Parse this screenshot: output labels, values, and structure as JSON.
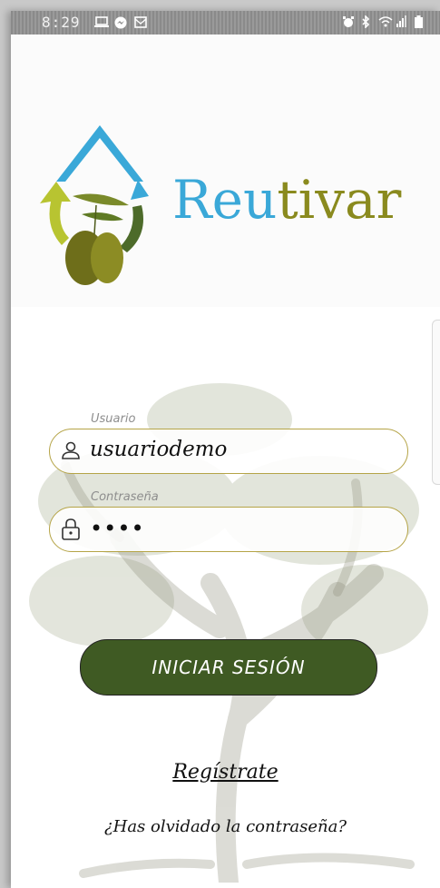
{
  "status_bar": {
    "time": "8:29",
    "left_icons": [
      "laptop-icon",
      "messenger-icon",
      "mail-icon"
    ],
    "right_icons": [
      "alarm-icon",
      "bluetooth-icon",
      "wifi-icon",
      "signal-icon",
      "battery-icon"
    ]
  },
  "brand": {
    "part1": "Reu",
    "part2": "tivar",
    "colors": {
      "blue": "#3aa8d8",
      "olive": "#8a8a1e",
      "dark_green": "#3f5a23"
    }
  },
  "form": {
    "username": {
      "label": "Usuario",
      "value": "usuariodemo",
      "icon": "user-icon"
    },
    "password": {
      "label": "Contraseña",
      "value": "••••",
      "icon": "lock-icon"
    },
    "login_button": "INICIAR SESIÓN",
    "register_link": "Regístrate",
    "forgot_link": "¿Has olvidado la contraseña?"
  }
}
